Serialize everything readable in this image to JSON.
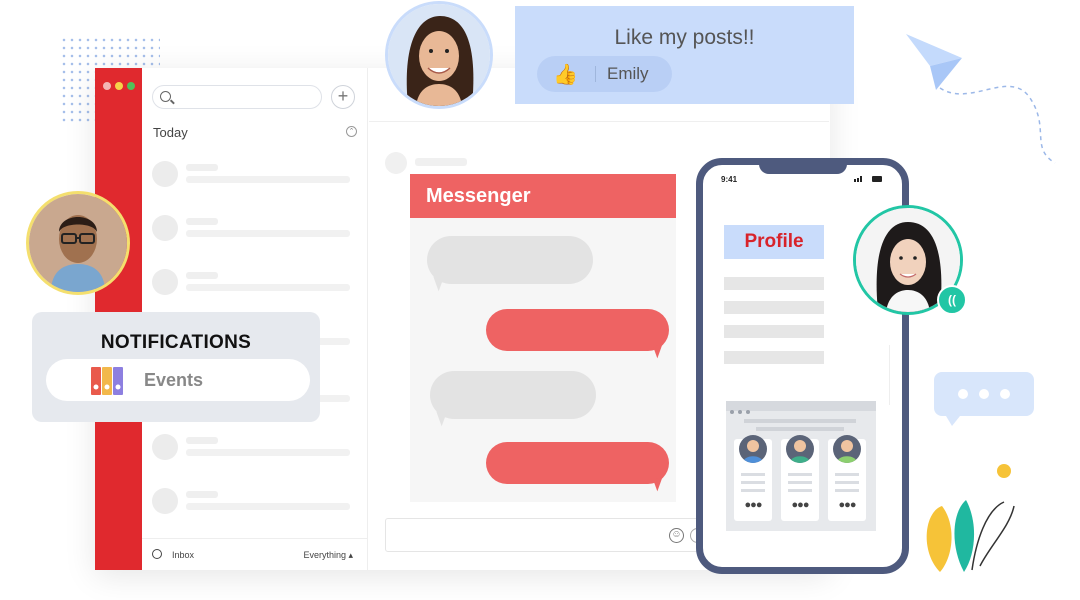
{
  "like_card": {
    "title": "Like my posts!!",
    "user": "Emily",
    "icon": "thumbs-up-icon"
  },
  "sidebar": {
    "search": {
      "placeholder": ""
    },
    "add_icon": "plus-icon",
    "section_title": "Today",
    "conversations": 7,
    "footer": {
      "inbox_label": "Inbox",
      "filter_label": "Everything ▴"
    }
  },
  "messenger": {
    "title": "Messenger",
    "bubbles": [
      "incoming",
      "outgoing",
      "incoming",
      "outgoing"
    ]
  },
  "notifications": {
    "title": "NOTIFICATIONS",
    "item_label": "Events",
    "item_icon": "binders-icon"
  },
  "phone": {
    "time": "9:41",
    "profile_label": "Profile",
    "cards": 3
  },
  "colors": {
    "brand_red": "#e0292e",
    "bubble_red": "#ee6363",
    "light_blue": "#c9dcfb",
    "phone_frame": "#4e5a7e",
    "teal": "#22c6a5"
  }
}
